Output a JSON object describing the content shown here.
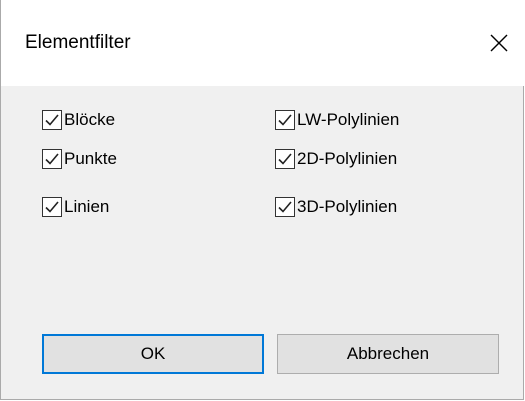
{
  "window": {
    "title": "Elementfilter"
  },
  "checkboxes": {
    "left": [
      {
        "label": "Blöcke",
        "checked": true
      },
      {
        "label": "Punkte",
        "checked": true
      },
      {
        "label": "Linien",
        "checked": true
      }
    ],
    "right": [
      {
        "label": "LW-Polylinien",
        "checked": true
      },
      {
        "label": "2D-Polylinien",
        "checked": true
      },
      {
        "label": "3D-Polylinien",
        "checked": true
      }
    ]
  },
  "buttons": {
    "ok_label": "OK",
    "cancel_label": "Abbrechen"
  },
  "colors": {
    "accent": "#0078d7",
    "dialog_background": "#f0f0f0",
    "button_face": "#e1e1e1"
  },
  "icons": {
    "close": "close-icon",
    "check": "checkmark-icon"
  }
}
